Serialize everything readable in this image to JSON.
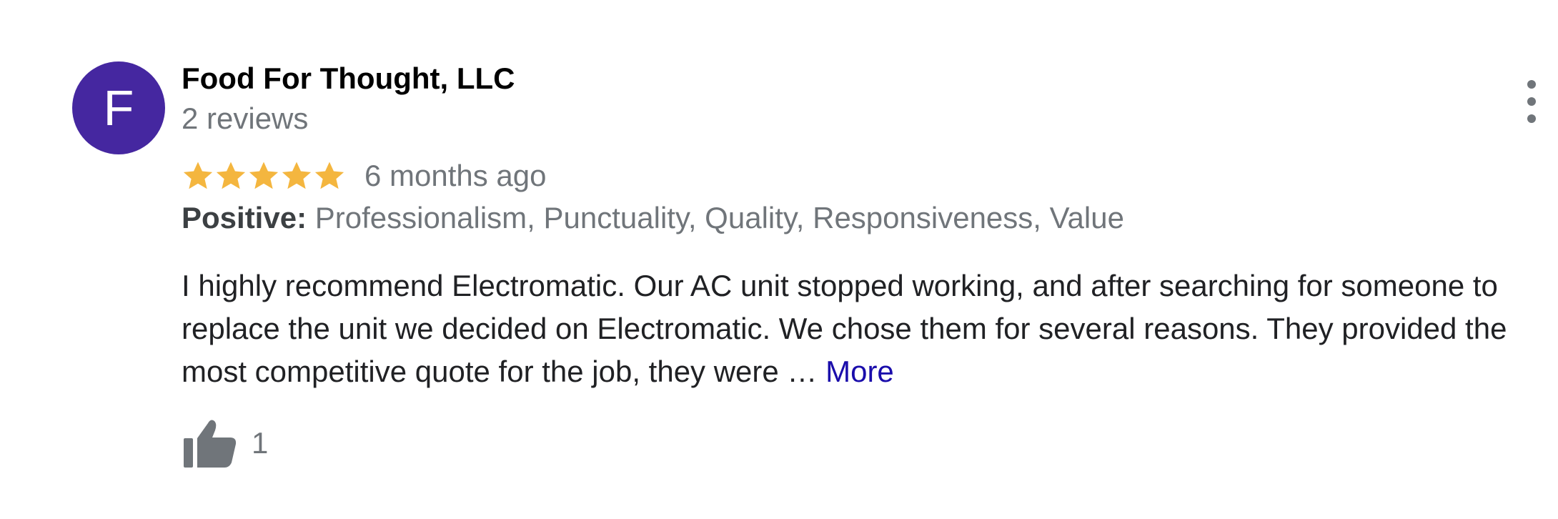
{
  "review": {
    "author": {
      "initial": "F",
      "name": "Food For Thought, LLC",
      "reviews_label": "2 reviews",
      "avatar_color": "#4527a0"
    },
    "menu_icon": "more-vertical-icon",
    "rating": {
      "stars": 5,
      "max_stars": 5,
      "star_color": "#f4b63f",
      "time_ago": "6 months ago"
    },
    "attributes": {
      "label": "Positive:",
      "values": " Professionalism, Punctuality, Quality, Responsiveness, Value"
    },
    "text_lines": [
      "I highly recommend Electromatic. Our AC unit stopped working, and after searching for someone to",
      "replace the unit we decided on Electromatic. We chose them for several reasons. They provided the",
      "most competitive quote for the job, they were … "
    ],
    "more_label": "More",
    "more_color": "#1a0dab",
    "likes": {
      "icon": "thumbs-up-icon",
      "count": "1"
    }
  }
}
